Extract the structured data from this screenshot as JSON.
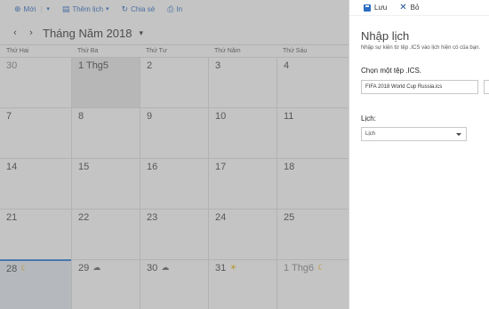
{
  "toolbar": {
    "new": "Mới",
    "add_calendar": "Thêm lịch",
    "share": "Chia sẻ",
    "print": "In"
  },
  "month_title": "Tháng Năm 2018",
  "weekdays": [
    "Thứ Hai",
    "Thứ Ba",
    "Thứ Tư",
    "Thứ Năm",
    "Thứ Sáu"
  ],
  "weeks": [
    [
      "30",
      "1 Thg5",
      "2",
      "3",
      "4"
    ],
    [
      "7",
      "8",
      "9",
      "10",
      "11"
    ],
    [
      "14",
      "15",
      "16",
      "17",
      "18"
    ],
    [
      "21",
      "22",
      "23",
      "24",
      "25"
    ],
    [
      "28",
      "29",
      "30",
      "31",
      "1 Thg6"
    ]
  ],
  "weather_icons": [
    "moon-icon",
    "cloud-icon",
    "cloud-icon",
    "sun-icon",
    "moon-icon"
  ],
  "panel": {
    "save": "Lưu",
    "discard": "Bỏ",
    "title": "Nhập lịch",
    "description": "Nhập sự kiện từ tệp .ICS vào lịch hiện có của bạn.",
    "choose_file_label": "Chọn một tệp .ICS.",
    "file_value": "FIFA 2018 World Cup Russia.ics",
    "calendar_label": "Lịch:",
    "calendar_selected": "Lịch"
  },
  "colors": {
    "accent": "#2b6cc4",
    "today_bar": "#2b7bd6",
    "weather_sun": "#e8b400"
  }
}
